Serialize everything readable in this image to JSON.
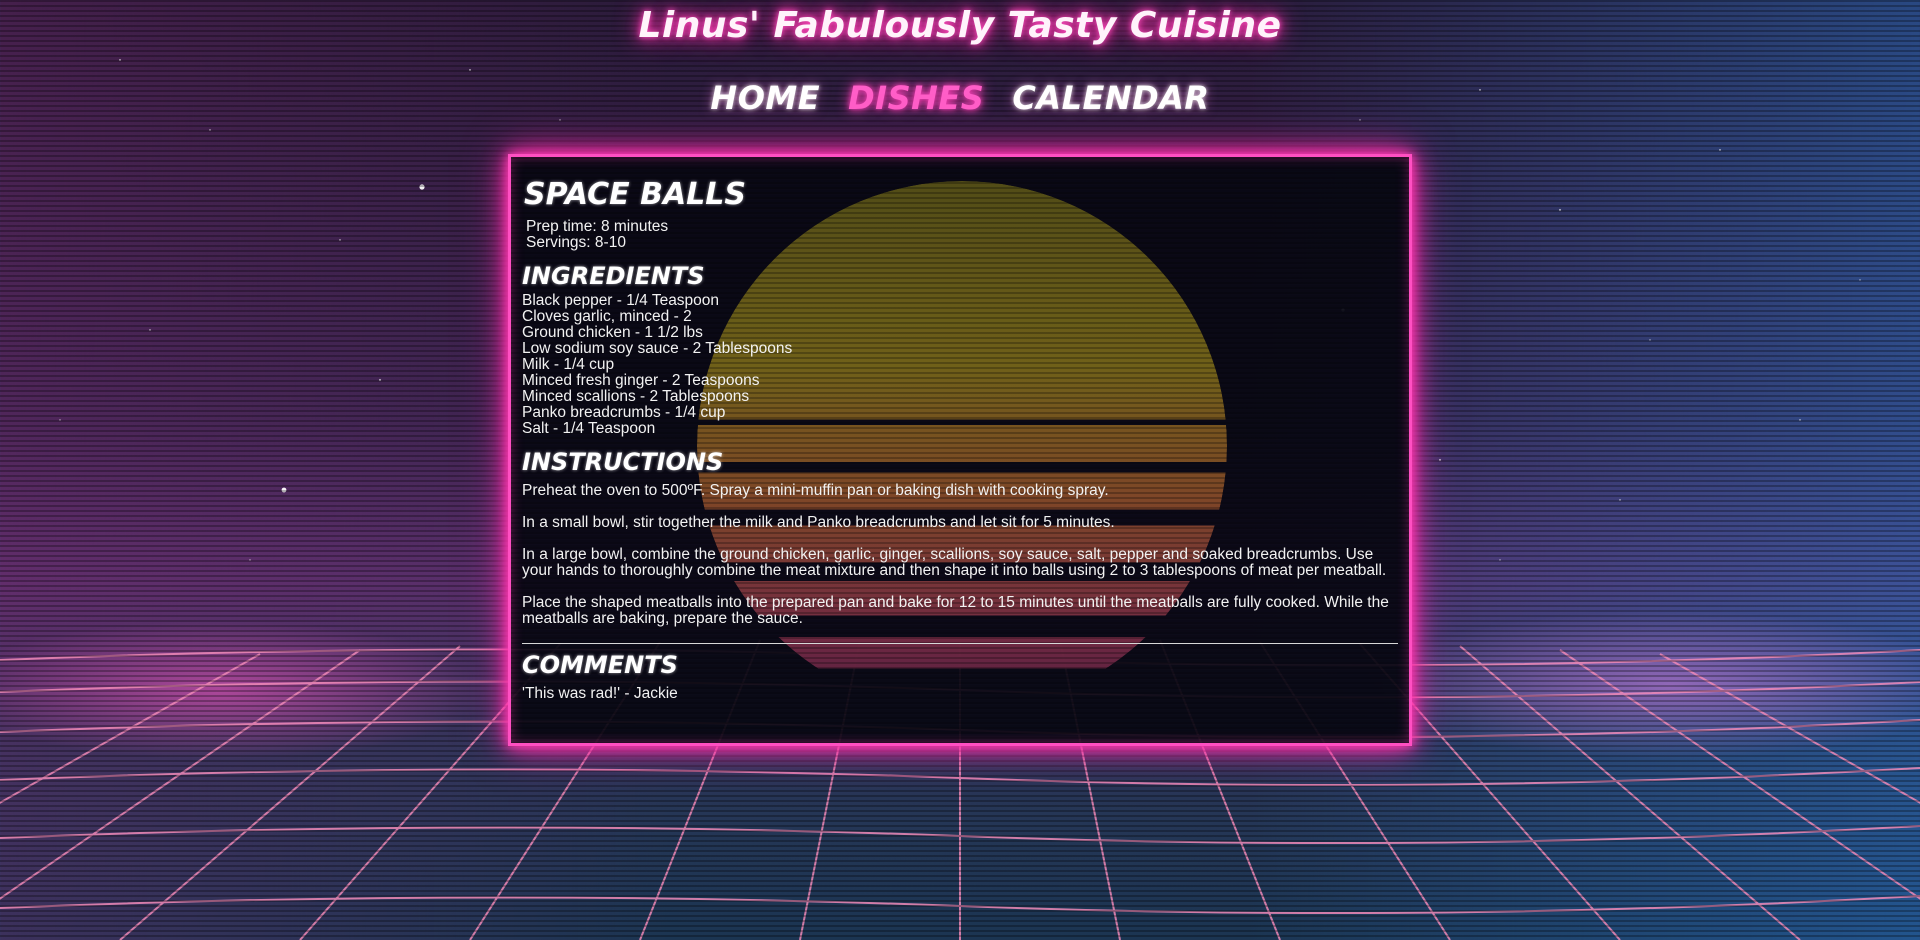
{
  "site": {
    "title": "Linus' Fabulously Tasty Cuisine",
    "accent_color": "#ff4fc2"
  },
  "nav": {
    "items": [
      {
        "label": "Home",
        "active": false
      },
      {
        "label": "Dishes",
        "active": true
      },
      {
        "label": "Calendar",
        "active": false
      }
    ]
  },
  "recipe": {
    "title": "Space Balls",
    "prep_time": "Prep time: 8 minutes",
    "servings": "Servings: 8-10",
    "ingredients_heading": "Ingredients",
    "ingredients": [
      "Black pepper - 1/4 Teaspoon",
      "Cloves garlic, minced - 2",
      "Ground chicken - 1 1/2 lbs",
      "Low sodium soy sauce - 2 Tablespoons",
      "Milk - 1/4 cup",
      "Minced fresh ginger - 2 Teaspoons",
      "Minced scallions - 2 Tablespoons",
      "Panko breadcrumbs - 1/4 cup",
      "Salt - 1/4 Teaspoon"
    ],
    "instructions_heading": "Instructions",
    "instructions": [
      "Preheat the oven to 500ºF. Spray a mini-muffin pan or baking dish with cooking spray.",
      "In a small bowl, stir together the milk and Panko breadcrumbs and let sit for 5 minutes.",
      "In a large bowl, combine the ground chicken, garlic, ginger, scallions, soy sauce, salt, pepper and soaked breadcrumbs. Use your hands to thoroughly combine the meat mixture and then shape it into balls using 2 to 3 tablespoons of meat per meatball.",
      "Place the shaped meatballs into the prepared pan and bake for 12 to 15 minutes until the meatballs are fully cooked. While the meatballs are baking, prepare the sauce."
    ],
    "comments_heading": "Comments",
    "comments": [
      "'This was rad!' - Jackie"
    ]
  }
}
